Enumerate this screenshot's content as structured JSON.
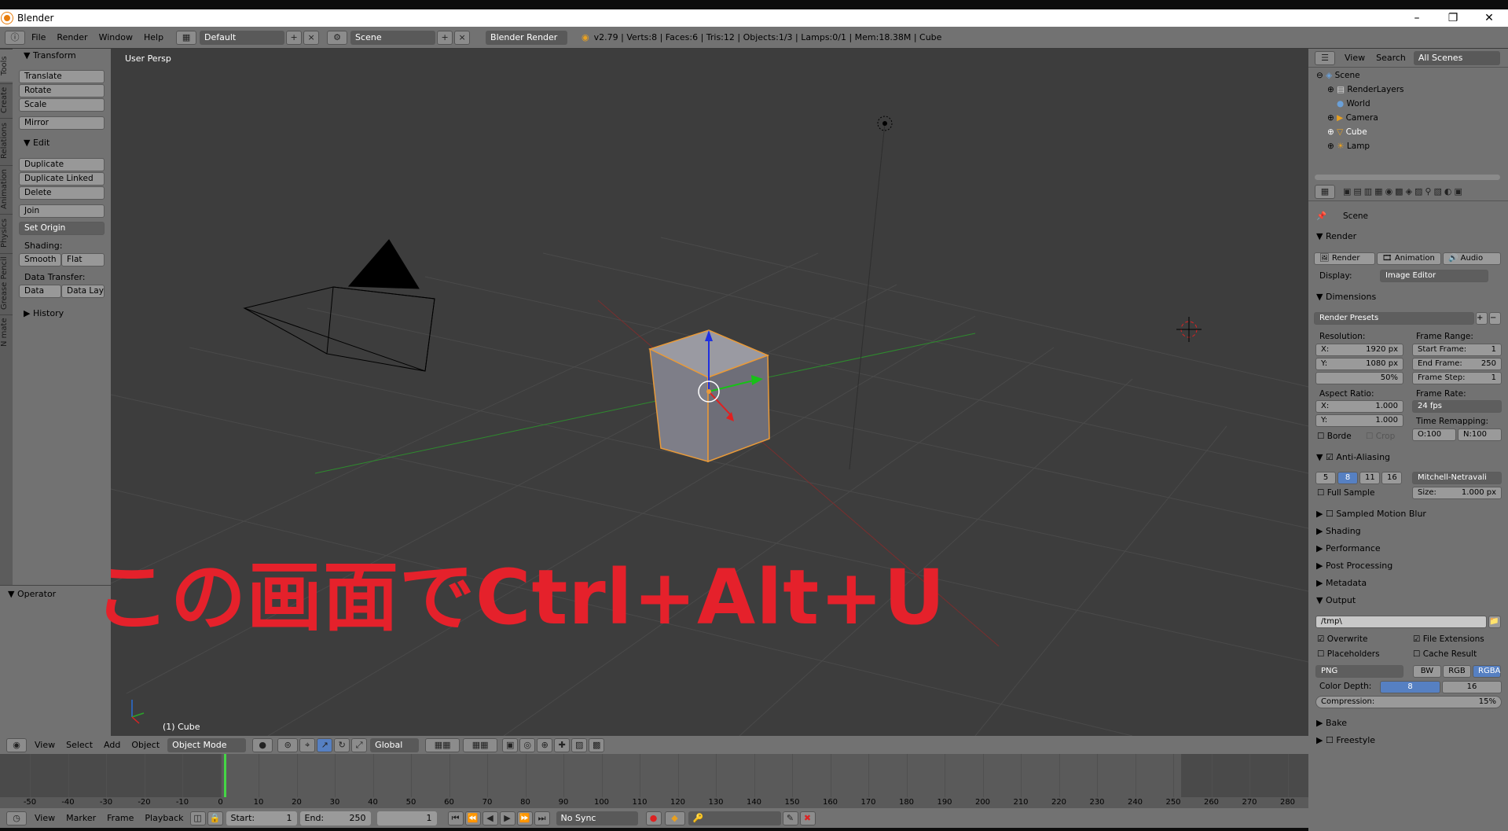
{
  "window": {
    "title": "Blender",
    "minimize": "–",
    "maximize": "❐",
    "close": "✕"
  },
  "topbar": {
    "menus": [
      "File",
      "Render",
      "Window",
      "Help"
    ],
    "layout": "Default",
    "scene": "Scene",
    "engine": "Blender Render",
    "info": "v2.79 | Verts:8 | Faces:6 | Tris:12 | Objects:1/3 | Lamps:0/1 | Mem:18.38M | Cube"
  },
  "tool_tabs": [
    "Tools",
    "Create",
    "Relations",
    "Animation",
    "Physics",
    "Grease Pencil",
    "N mate"
  ],
  "toolshelf": {
    "transform": "Transform",
    "translate": "Translate",
    "rotate": "Rotate",
    "scale": "Scale",
    "mirror": "Mirror",
    "edit": "Edit",
    "duplicate": "Duplicate",
    "duplicate_linked": "Duplicate Linked",
    "delete": "Delete",
    "join": "Join",
    "set_origin": "Set Origin",
    "shading": "Shading:",
    "smooth": "Smooth",
    "flat": "Flat",
    "data_transfer": "Data Transfer:",
    "data": "Data",
    "data_layo": "Data Layo",
    "history": "History"
  },
  "operator": "Operator",
  "viewport": {
    "label": "User Persp",
    "object": "(1) Cube",
    "overlay": "この画面でCtrl+Alt+U"
  },
  "outliner": {
    "view": "View",
    "search": "Search",
    "filter": "All Scenes",
    "items": [
      "Scene",
      "RenderLayers",
      "World",
      "Camera",
      "Cube",
      "Lamp"
    ]
  },
  "props": {
    "scene": "Scene",
    "render": "Render",
    "render_btn": "Render",
    "anim_btn": "Animation",
    "audio_btn": "Audio",
    "display_lbl": "Display:",
    "display_val": "Image Editor",
    "dimensions": "Dimensions",
    "presets": "Render Presets",
    "resolution": "Resolution:",
    "res_x": "X:",
    "res_x_val": "1920 px",
    "res_y": "Y:",
    "res_y_val": "1080 px",
    "res_pct": "50%",
    "frame_range": "Frame Range:",
    "start_frame": "Start Frame:",
    "start_val": "1",
    "end_frame": "End Frame:",
    "end_val": "250",
    "frame_step": "Frame Step:",
    "step_val": "1",
    "aspect": "Aspect Ratio:",
    "asp_x": "X:",
    "asp_x_val": "1.000",
    "asp_y": "Y:",
    "asp_y_val": "1.000",
    "frame_rate": "Frame Rate:",
    "fps": "24 fps",
    "time_remap": "Time Remapping:",
    "o_val": "O:100",
    "n_val": "N:100",
    "borde": "Borde",
    "crop": "Crop",
    "anti_aliasing": "Anti-Aliasing",
    "aa": [
      "5",
      "8",
      "11",
      "16"
    ],
    "filter": "Mitchell-Netravali",
    "full_sample": "Full Sample",
    "size": "Size:",
    "size_val": "1.000 px",
    "sampled_mb": "Sampled Motion Blur",
    "shading": "Shading",
    "performance": "Performance",
    "post_processing": "Post Processing",
    "metadata": "Metadata",
    "output": "Output",
    "path": "/tmp\\",
    "overwrite": "Overwrite",
    "file_ext": "File Extensions",
    "placeholders": "Placeholders",
    "cache": "Cache Result",
    "format": "PNG",
    "bw": "BW",
    "rgb": "RGB",
    "rgba": "RGBA",
    "color_depth": "Color Depth:",
    "cd8": "8",
    "cd16": "16",
    "compression": "Compression:",
    "comp_val": "15%",
    "bake": "Bake",
    "freestyle": "Freestyle"
  },
  "view3d_header": {
    "view": "View",
    "select": "Select",
    "add": "Add",
    "object": "Object",
    "mode": "Object Mode",
    "orientation": "Global"
  },
  "timeline": {
    "ticks": [
      "-50",
      "-40",
      "-30",
      "-20",
      "-10",
      "0",
      "10",
      "20",
      "30",
      "40",
      "50",
      "60",
      "70",
      "80",
      "90",
      "100",
      "110",
      "120",
      "130",
      "140",
      "150",
      "160",
      "170",
      "180",
      "190",
      "200",
      "210",
      "220",
      "230",
      "240",
      "250",
      "260",
      "270",
      "280"
    ]
  },
  "timeline_header": {
    "view": "View",
    "marker": "Marker",
    "frame": "Frame",
    "playback": "Playback",
    "start": "Start:",
    "start_val": "1",
    "end": "End:",
    "end_val": "250",
    "current": "1",
    "sync": "No Sync"
  }
}
